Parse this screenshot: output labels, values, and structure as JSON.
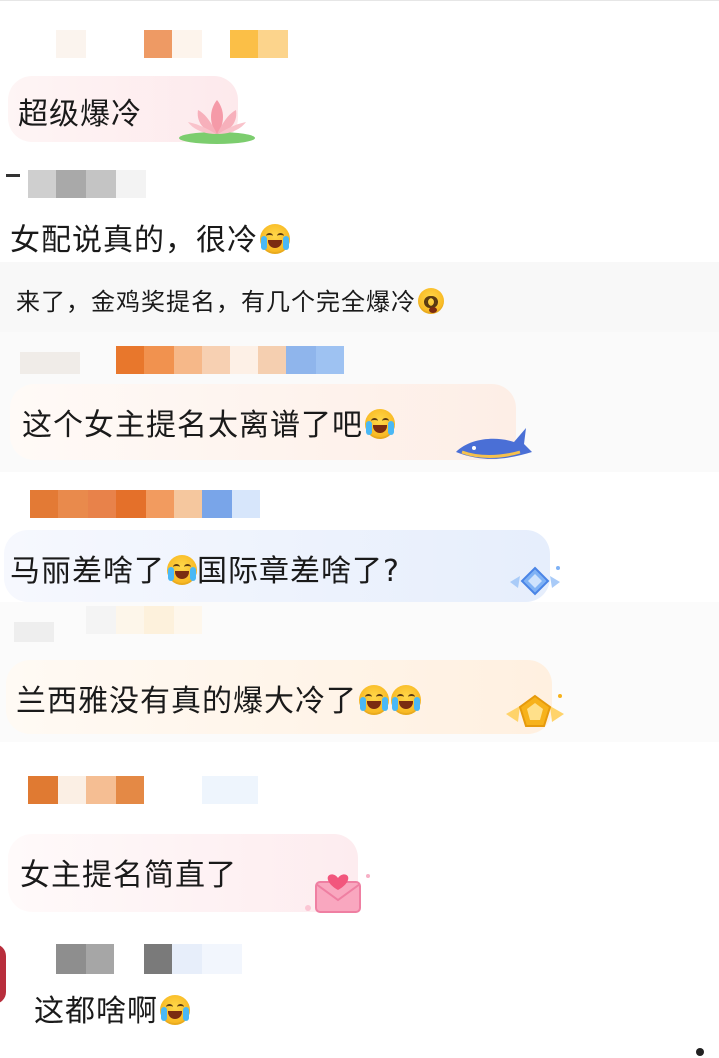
{
  "comments": [
    {
      "text": "超级爆冷",
      "emoji": ""
    },
    {
      "text": "女配说真的，很冷",
      "emoji": "laugh-cry-emoji"
    },
    {
      "text": "来了，金鸡奖提名，有几个完全爆冷",
      "emoji": "shocked-emoji"
    },
    {
      "text": "这个女主提名太离谱了吧",
      "emoji": "crying-emoji"
    },
    {
      "text_a": "马丽差啥了",
      "text_b": "国际章差啥了?",
      "emoji": "laugh-cry-emoji"
    },
    {
      "text": "兰西雅没有真的爆大冷了",
      "emoji": "crying-emoji"
    },
    {
      "text": "女主提名简直了",
      "emoji": ""
    },
    {
      "text": "这都啥啊",
      "emoji": "laugh-cry-emoji"
    }
  ],
  "colors": {
    "bubble_pink": "#fdeff0",
    "bubble_blue": "#eaf1fd",
    "bubble_peach": "#fff1e6",
    "text": "#1a1a1a"
  }
}
